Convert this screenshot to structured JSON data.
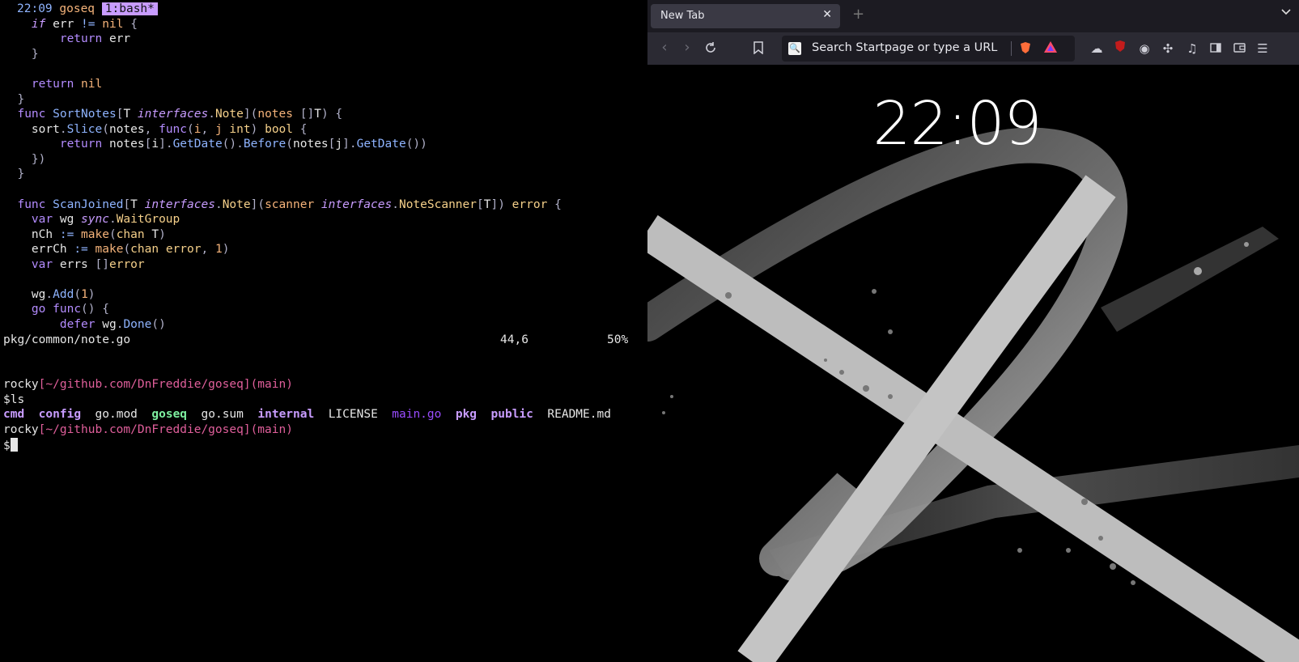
{
  "terminal": {
    "tmux": {
      "clock": "22:09",
      "session": "goseq",
      "window": "1:bash*"
    },
    "vim_status": {
      "file": "pkg/common/note.go",
      "position": "44,6",
      "percent": "50%"
    },
    "prompt": {
      "user": "rocky",
      "path": "[~/github.com/DnFreddie/goseq]",
      "branch": "(main)",
      "symbol": "$"
    },
    "command": "ls",
    "ls_output": {
      "cmd": "cmd",
      "config": "config",
      "gomod": "go.mod",
      "goseq": "goseq",
      "gosum": "go.sum",
      "internal": "internal",
      "license": "LICENSE",
      "maingo": "main.go",
      "pkg": "pkg",
      "public": "public",
      "readme": "README.md"
    }
  },
  "browser": {
    "tab_title": "New Tab",
    "url_placeholder": "Search Startpage or type a URL",
    "clock": "22:09"
  },
  "colors": {
    "terminal_bg": "#000000",
    "browser_chrome": "#2b2a33",
    "tmux_window": "#c89cff",
    "prompt": "#e05f9b"
  }
}
